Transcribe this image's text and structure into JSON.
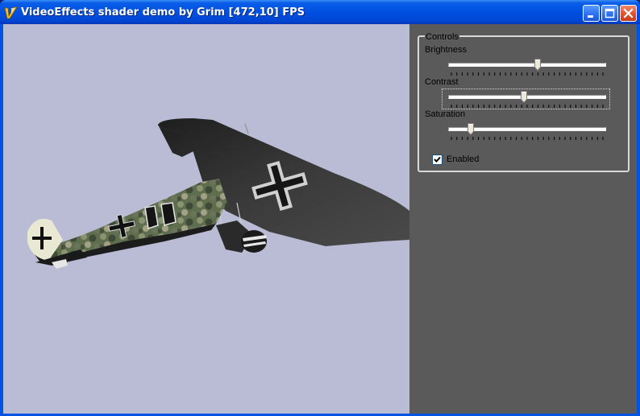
{
  "window": {
    "title": "VideoEffects shader demo by Grim [472,10] FPS",
    "app_icon": "delphi-app-icon",
    "buttons": {
      "minimize": "minimize-icon",
      "maximize": "maximize-icon",
      "close": "close-icon"
    }
  },
  "viewport": {
    "background_color": "#babcd6",
    "scene": "biplane-render"
  },
  "controls": {
    "group_label": "Controls",
    "brightness": {
      "label": "Brightness",
      "value": 0.57
    },
    "contrast": {
      "label": "Contrast",
      "value": 0.48
    },
    "saturation": {
      "label": "Saturation",
      "value": 0.13
    },
    "enabled": {
      "label": "Enabled",
      "checked": true
    }
  },
  "colors": {
    "titlebar": "#0054e3",
    "panel": "#5a5a5a",
    "close_button": "#e0502c"
  }
}
